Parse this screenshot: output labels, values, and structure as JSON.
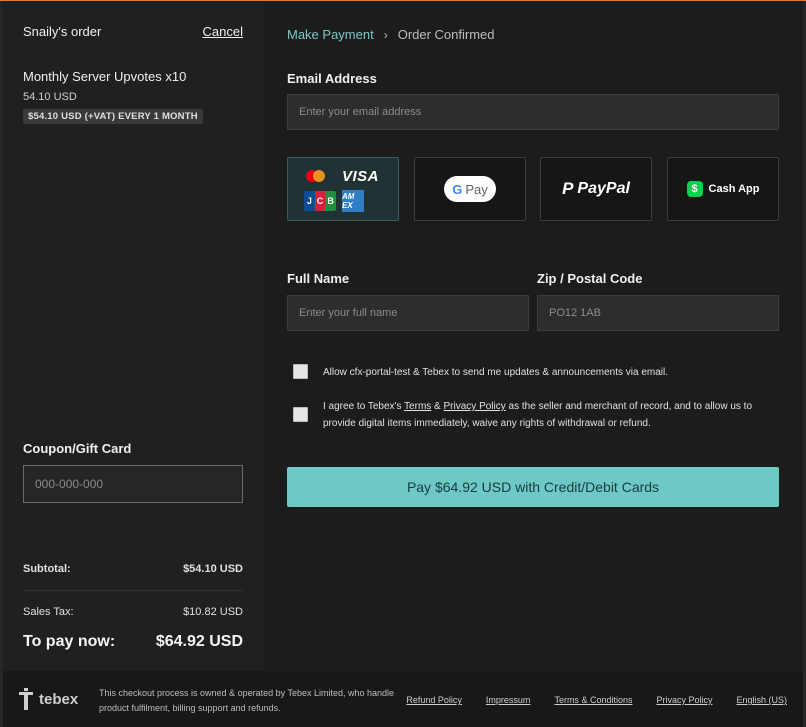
{
  "sidebar": {
    "order_title": "Snaily's order",
    "cancel_label": "Cancel",
    "item": {
      "name": "Monthly Server Upvotes x10",
      "price": "54.10 USD",
      "badge": "$54.10 USD (+VAT) EVERY 1 MONTH"
    },
    "coupon": {
      "label": "Coupon/Gift Card",
      "placeholder": "000-000-000"
    },
    "summary": {
      "subtotal_label": "Subtotal:",
      "subtotal_value": "$54.10 USD",
      "tax_label": "Sales Tax:",
      "tax_value": "$10.82 USD",
      "total_label": "To pay now:",
      "total_value": "$64.92 USD"
    }
  },
  "main": {
    "breadcrumb": {
      "link": "Make Payment",
      "separator": "›",
      "current": "Order Confirmed"
    },
    "email": {
      "label": "Email Address",
      "placeholder": "Enter your email address"
    },
    "payment_methods": {
      "visa_text": "VISA",
      "jcb_letters": [
        "J",
        "C",
        "B"
      ],
      "amex_text": "AM EX",
      "gpay_g": "G",
      "gpay_text": "Pay",
      "paypal_icon": "P",
      "paypal_text": "PayPal",
      "cashapp_icon": "$",
      "cashapp_text": "Cash App",
      "selected": "cards"
    },
    "full_name": {
      "label": "Full Name",
      "placeholder": "Enter your full name"
    },
    "zip": {
      "label": "Zip / Postal Code",
      "placeholder": "PO12 1AB"
    },
    "consent_updates": "Allow cfx-portal-test & Tebex to send me updates & announcements via email.",
    "consent_terms": {
      "prefix": "I agree to Tebex's ",
      "terms_link": "Terms",
      "amp": " & ",
      "privacy_link": "Privacy Policy",
      "suffix": " as the seller and merchant of record, and to allow us to provide digital items immediately, waive any rights of withdrawal or refund."
    },
    "pay_button_label": "Pay $64.92 USD with Credit/Debit Cards"
  },
  "footer": {
    "logo_text": "tebex",
    "description": "This checkout process is owned & operated by Tebex Limited, who handle product fulfilment, billing support and refunds.",
    "links": [
      "Refund Policy",
      "Impressum",
      "Terms & Conditions",
      "Privacy Policy",
      "English (US)"
    ]
  },
  "colors": {
    "accent": "#6ec8c6",
    "link": "#7cc6c4",
    "top_line": "#e07a2e"
  }
}
